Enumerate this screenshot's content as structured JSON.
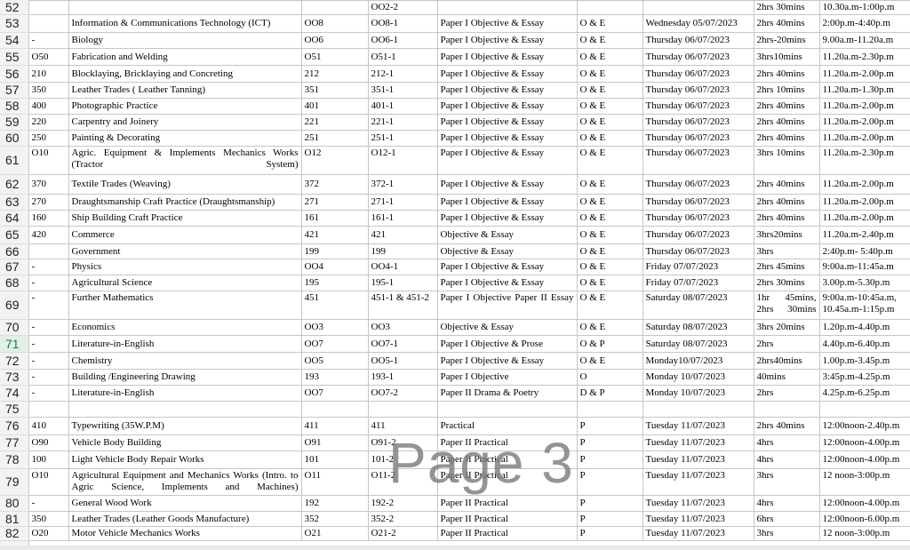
{
  "selected_row": "71",
  "rows": [
    {
      "rh": "52",
      "h": 16,
      "c": [
        "",
        "",
        "",
        "OO2-2",
        "",
        "",
        "",
        "2hrs 30mins",
        "10.30a.m-1:00p.m"
      ]
    },
    {
      "rh": "53",
      "h": 20,
      "c": [
        "",
        "Information & Communications Technology (ICT)",
        "OO8",
        "OO8-1",
        "Paper I Objective & Essay",
        "O & E",
        "Wednesday 05/07/2023",
        "2hrs 40mins",
        "2:00p.m-4:40p.m"
      ]
    },
    {
      "rh": "54",
      "h": 18,
      "c": [
        "-",
        "Biology",
        "OO6",
        "OO6-1",
        "Paper I Objective & Essay",
        "O & E",
        "Thursday 06/07/2023",
        "2hrs-20mins",
        "9.00a.m-11.20a.m"
      ]
    },
    {
      "rh": "55",
      "h": 19,
      "c": [
        "O50",
        "Fabrication and Welding",
        "O51",
        "O51-1",
        "Paper I Objective & Essay",
        "O & E",
        "Thursday 06/07/2023",
        "3hrs10mins",
        "11.20a.m-2.30p.m"
      ]
    },
    {
      "rh": "56",
      "h": 19,
      "c": [
        "210",
        "Blocklaying, Bricklaying and Concreting",
        "212",
        "212-1",
        "Paper I Objective & Essay",
        "O & E",
        "Thursday 06/07/2023",
        "2hrs 40mins",
        "11.20a.m-2.00p.m"
      ]
    },
    {
      "rh": "57",
      "h": 18,
      "c": [
        "350",
        "Leather Trades ( Leather Tanning)",
        "351",
        "351-1",
        "Paper I Objective & Essay",
        "O & E",
        "Thursday 06/07/2023",
        "2hrs 10mins",
        "11.20a.m-1.30p.m"
      ]
    },
    {
      "rh": "58",
      "h": 18,
      "c": [
        "400",
        "Photographic Practice",
        "401",
        "401-1",
        "Paper I Objective & Essay",
        "O & E",
        "Thursday 06/07/2023",
        "2hrs 40mins",
        "11.20a.m-2.00p.m"
      ]
    },
    {
      "rh": "59",
      "h": 18,
      "c": [
        "220",
        "Carpentry and Joinery",
        "221",
        "221-1",
        "Paper I Objective & Essay",
        "O & E",
        "Thursday 06/07/2023",
        "2hrs 40mins",
        "11.20a.m-2.00p.m"
      ]
    },
    {
      "rh": "60",
      "h": 18,
      "c": [
        "250",
        "Painting & Decorating",
        "251",
        "251-1",
        "Paper I Objective & Essay",
        "O & E",
        "Thursday 06/07/2023",
        "2hrs 40mins",
        "11.20a.m-2.00p.m"
      ]
    },
    {
      "rh": "61",
      "h": 32,
      "c": [
        "O10",
        "Agric. Equipment & Implements Mechanics Works (Tractor System)",
        "O12",
        "O12-1",
        "Paper I Objective & Essay",
        "O & E",
        "Thursday 06/07/2023",
        "3hrs 10mins",
        "11.20a.m-2.30p.m"
      ]
    },
    {
      "rh": "62",
      "h": 22,
      "c": [
        "370",
        "Textile Trades (Weaving)",
        "372",
        "372-1",
        "Paper I Objective & Essay",
        "O & E",
        "Thursday 06/07/2023",
        "2hrs 40mins",
        "11.20a.m-2.00p.m"
      ]
    },
    {
      "rh": "63",
      "h": 18,
      "c": [
        "270",
        "Draughtsmanship Craft Practice (Draughtsmanship)",
        "271",
        "271-1",
        "Paper I Objective & Essay",
        "O & E",
        "Thursday 06/07/2023",
        "2hrs 40mins",
        "11.20a.m-2.00p.m"
      ]
    },
    {
      "rh": "64",
      "h": 18,
      "c": [
        "160",
        "Ship Building Craft Practice",
        "161",
        "161-1",
        "Paper I Objective & Essay",
        "O & E",
        "Thursday 06/07/2023",
        "2hrs 40mins",
        "11.20a.m-2.00p.m"
      ]
    },
    {
      "rh": "65",
      "h": 20,
      "c": [
        "420",
        "Commerce",
        "421",
        "421",
        "Objective & Essay",
        "O & E",
        "Thursday 06/07/2023",
        "3hrs20mins",
        "11.20a.m-2.40p.m"
      ]
    },
    {
      "rh": "66",
      "h": 17,
      "c": [
        "",
        "Government",
        "199",
        "199",
        "Objective & Essay",
        "O & E",
        "Thursday 06/07/2023",
        "3hrs",
        "2:40p.m- 5:40p.m"
      ]
    },
    {
      "rh": "67",
      "h": 18,
      "c": [
        "-",
        " Physics",
        "OO4",
        "OO4-1",
        "Paper I Objective & Essay",
        "O & E",
        "Friday 07/07/2023",
        "2hrs 45mins",
        "9:00a.m-11:45a.m"
      ]
    },
    {
      "rh": "68",
      "h": 18,
      "c": [
        "-",
        "Agricultural Science",
        "195",
        "195-1",
        "Paper I Objective & Essay",
        "O & E",
        "Friday 07/07/2023",
        "2hrs 30mins",
        "3.00p.m-5.30p.m"
      ]
    },
    {
      "rh": "69",
      "h": 32,
      "c": [
        "-",
        "Further Mathematics",
        "451",
        "451-1 & 451-2",
        "Paper I Objective Paper II Essay",
        "O & E",
        "Saturday 08/07/2023",
        "1hr 45mins, 2hrs 30mins",
        "9:00a.m-10:45a.m, 10.45a.m-1:15p.m"
      ]
    },
    {
      "rh": "70",
      "h": 18,
      "c": [
        "-",
        "Economics",
        "OO3",
        "OO3",
        "Objective & Essay",
        "O & E",
        "Saturday 08/07/2023",
        "3hrs 20mins",
        "1.20p.m-4.40p.m"
      ]
    },
    {
      "rh": "71",
      "h": 19,
      "c": [
        "-",
        "Literature-in-English",
        "OO7",
        "OO7-1",
        "Paper I Objective & Prose",
        "O & P",
        "Saturday 08/07/2023",
        "2hrs",
        "4.40p.m-6.40p.m"
      ]
    },
    {
      "rh": "72",
      "h": 19,
      "c": [
        "-",
        "Chemistry",
        "OO5",
        "OO5-1",
        "Paper I Objective & Essay",
        "O & E",
        "Monday10/07/2023",
        "2hrs40mins",
        "1.00p.m-3.45p.m"
      ]
    },
    {
      "rh": "73",
      "h": 18,
      "c": [
        "-",
        "Building /Engineering Drawing",
        "193",
        "193-1",
        "Paper I Objective",
        "O",
        "Monday 10/07/2023",
        "40mins",
        "3:45p.m-4.25p.m"
      ]
    },
    {
      "rh": "74",
      "h": 18,
      "c": [
        "-",
        "Literature-in-English",
        "OO7",
        "OO7-2",
        "Paper II Drama & Poetry",
        "D & P",
        "Monday 10/07/2023",
        "2hrs",
        "4.25p.m-6.25p.m"
      ]
    },
    {
      "rh": "75",
      "h": 18,
      "c": [
        "",
        "",
        "",
        "",
        "",
        "",
        "",
        "",
        ""
      ]
    },
    {
      "rh": "76",
      "h": 20,
      "c": [
        "410",
        "Typewriting (35W.P.M)",
        "411",
        "411",
        "Practical",
        "P",
        "Tuesday 11/07/2023",
        "2hrs 40mins",
        "12:00noon-2.40p.m"
      ]
    },
    {
      "rh": "77",
      "h": 18,
      "c": [
        "O90",
        "Vehicle Body Building",
        "O91",
        "O91-2",
        "Paper II Practical",
        "P",
        "Tuesday 11/07/2023",
        "4hrs",
        "12:00noon-4.00p.m"
      ]
    },
    {
      "rh": "78",
      "h": 20,
      "c": [
        "100",
        "Light Vehicle Body Repair Works",
        "101",
        "101-2",
        "Paper II Practical",
        "P",
        "Tuesday 11/07/2023",
        "4hrs",
        "12:00noon-4.00p.m"
      ]
    },
    {
      "rh": "79",
      "h": 30,
      "c": [
        "O10",
        "Agricultural Equipment and Mechanics Works (Intro. to Agric Science, Implements and Machines)",
        "O11",
        "O11-2",
        "Paper II Practical",
        "P",
        "Tuesday 11/07/2023",
        "3hrs",
        "12 noon-3:00p.m"
      ]
    },
    {
      "rh": "80",
      "h": 18,
      "c": [
        "-",
        "General Wood Work",
        "192",
        "192-2",
        "Paper II Practical",
        "P",
        "Tuesday 11/07/2023",
        "4hrs",
        "12:00noon-4.00p.m"
      ]
    },
    {
      "rh": "81",
      "h": 17,
      "c": [
        "350",
        "Leather Trades (Leather Goods Manufacture)",
        "352",
        "352-2",
        "Paper II Practical",
        "P",
        "Tuesday 11/07/2023",
        "6hrs",
        "12:00noon-6.00p.m"
      ]
    },
    {
      "rh": "82",
      "h": 16,
      "c": [
        "O20",
        "Motor Vehicle Mechanics Works",
        "O21",
        "O21-2",
        "Paper II Practical",
        "P",
        "Tuesday 11/07/2023",
        "3hrs",
        "12 noon-3:00p.m"
      ]
    }
  ],
  "watermark": "Page 3",
  "colors": {
    "selected_header": "#217346",
    "page_break": "#1f3f9f",
    "watermark": "#7d7d7d"
  }
}
